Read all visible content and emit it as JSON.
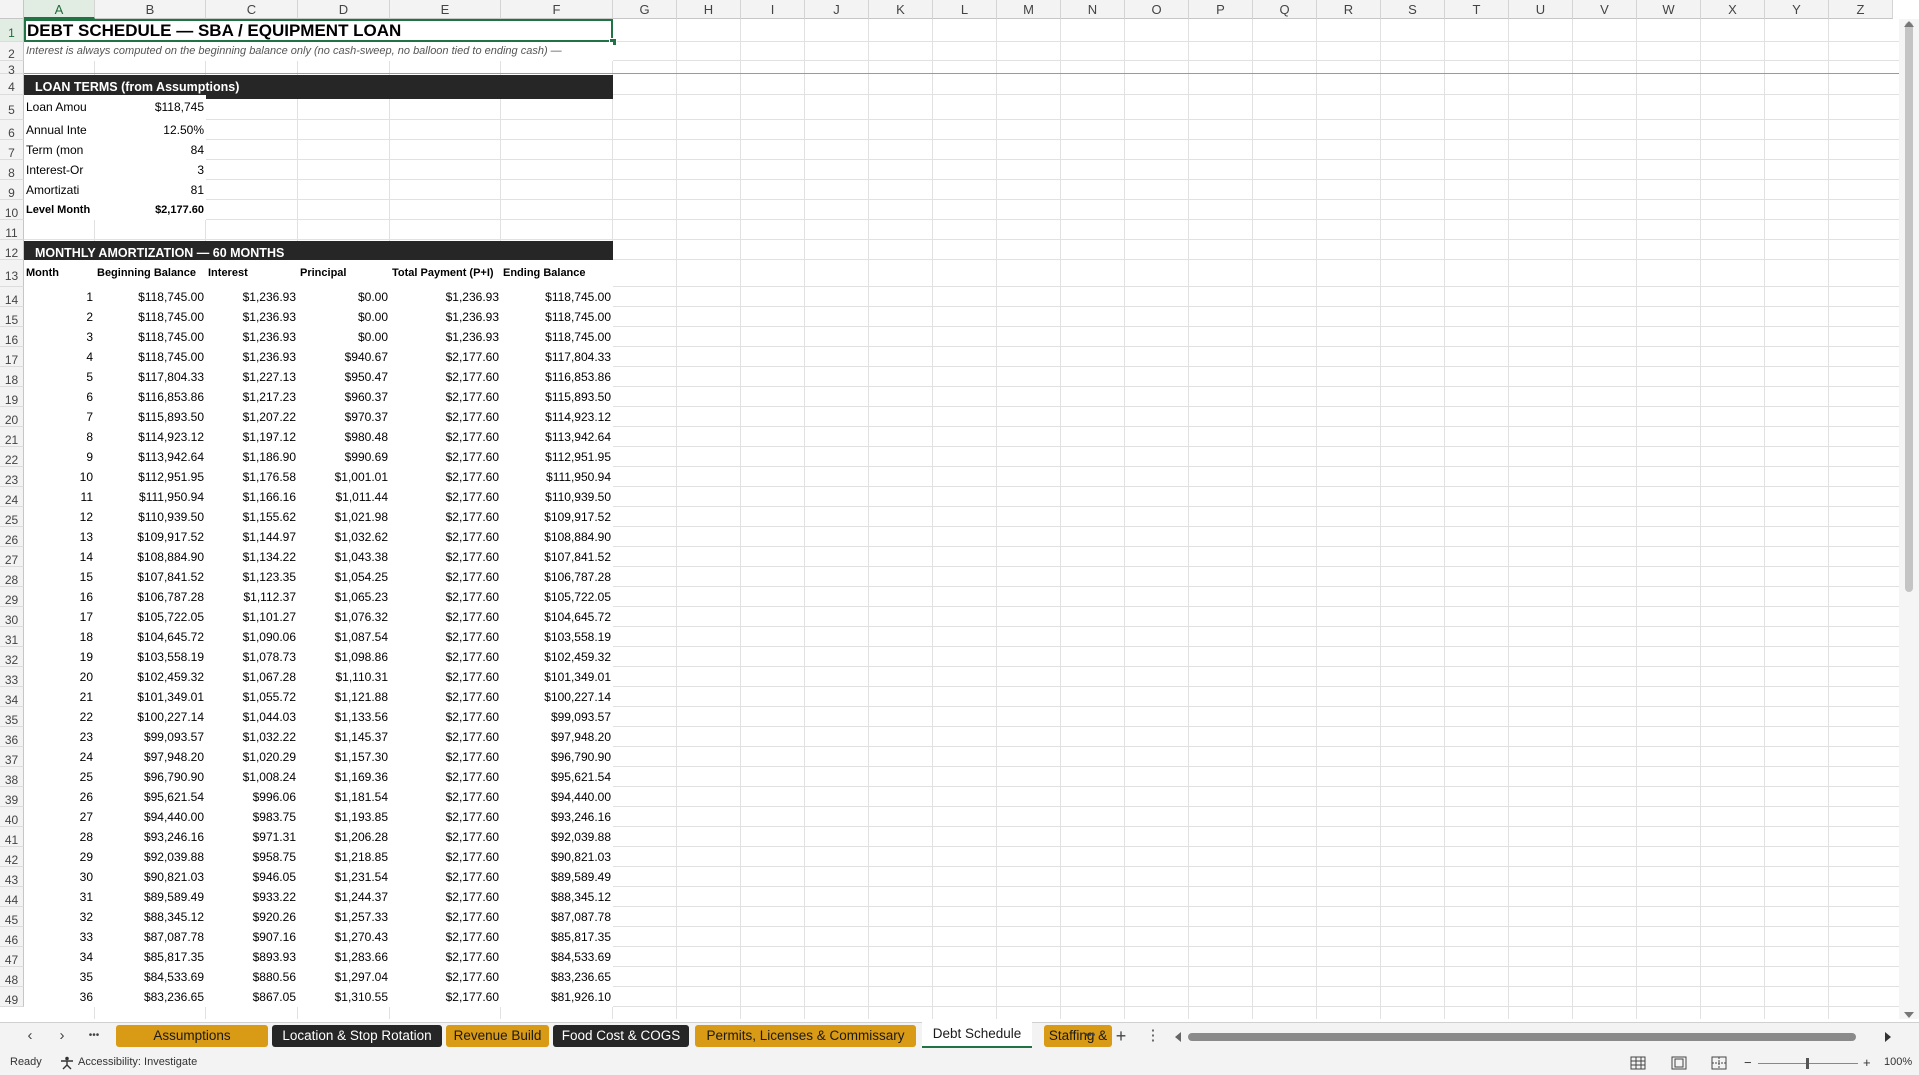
{
  "columns": [
    "A",
    "B",
    "C",
    "D",
    "E",
    "F",
    "G",
    "H",
    "I",
    "J",
    "K",
    "L",
    "M",
    "N",
    "O",
    "P",
    "Q",
    "R",
    "S",
    "T",
    "U",
    "V",
    "W",
    "X",
    "Y",
    "Z"
  ],
  "selected_column": "A",
  "selected_row": "1",
  "sheet": {
    "title": "DEBT SCHEDULE — SBA / EQUIPMENT LOAN",
    "note": "Interest is always computed on the beginning balance only (no cash-sweep, no balloon tied to ending cash) —",
    "loan_terms_header": "LOAN TERMS (from Assumptions)",
    "loan_terms": [
      {
        "label": "Loan Amou",
        "value": "$118,745"
      },
      {
        "label": "Annual Inte",
        "value": "12.50%"
      },
      {
        "label": "Term (mon",
        "value": "84"
      },
      {
        "label": "Interest-Or",
        "value": "3"
      },
      {
        "label": "Amortizati",
        "value": "81"
      },
      {
        "label": "Level Month",
        "value": "$2,177.60"
      }
    ],
    "amort_header": "MONTHLY AMORTIZATION — 60 MONTHS",
    "table_headers": [
      "Month",
      "Beginning Balance",
      "Interest",
      "Principal",
      "Total Payment (P+I)",
      "Ending Balance"
    ],
    "rows": [
      [
        "1",
        "$118,745.00",
        "$1,236.93",
        "$0.00",
        "$1,236.93",
        "$118,745.00"
      ],
      [
        "2",
        "$118,745.00",
        "$1,236.93",
        "$0.00",
        "$1,236.93",
        "$118,745.00"
      ],
      [
        "3",
        "$118,745.00",
        "$1,236.93",
        "$0.00",
        "$1,236.93",
        "$118,745.00"
      ],
      [
        "4",
        "$118,745.00",
        "$1,236.93",
        "$940.67",
        "$2,177.60",
        "$117,804.33"
      ],
      [
        "5",
        "$117,804.33",
        "$1,227.13",
        "$950.47",
        "$2,177.60",
        "$116,853.86"
      ],
      [
        "6",
        "$116,853.86",
        "$1,217.23",
        "$960.37",
        "$2,177.60",
        "$115,893.50"
      ],
      [
        "7",
        "$115,893.50",
        "$1,207.22",
        "$970.37",
        "$2,177.60",
        "$114,923.12"
      ],
      [
        "8",
        "$114,923.12",
        "$1,197.12",
        "$980.48",
        "$2,177.60",
        "$113,942.64"
      ],
      [
        "9",
        "$113,942.64",
        "$1,186.90",
        "$990.69",
        "$2,177.60",
        "$112,951.95"
      ],
      [
        "10",
        "$112,951.95",
        "$1,176.58",
        "$1,001.01",
        "$2,177.60",
        "$111,950.94"
      ],
      [
        "11",
        "$111,950.94",
        "$1,166.16",
        "$1,011.44",
        "$2,177.60",
        "$110,939.50"
      ],
      [
        "12",
        "$110,939.50",
        "$1,155.62",
        "$1,021.98",
        "$2,177.60",
        "$109,917.52"
      ],
      [
        "13",
        "$109,917.52",
        "$1,144.97",
        "$1,032.62",
        "$2,177.60",
        "$108,884.90"
      ],
      [
        "14",
        "$108,884.90",
        "$1,134.22",
        "$1,043.38",
        "$2,177.60",
        "$107,841.52"
      ],
      [
        "15",
        "$107,841.52",
        "$1,123.35",
        "$1,054.25",
        "$2,177.60",
        "$106,787.28"
      ],
      [
        "16",
        "$106,787.28",
        "$1,112.37",
        "$1,065.23",
        "$2,177.60",
        "$105,722.05"
      ],
      [
        "17",
        "$105,722.05",
        "$1,101.27",
        "$1,076.32",
        "$2,177.60",
        "$104,645.72"
      ],
      [
        "18",
        "$104,645.72",
        "$1,090.06",
        "$1,087.54",
        "$2,177.60",
        "$103,558.19"
      ],
      [
        "19",
        "$103,558.19",
        "$1,078.73",
        "$1,098.86",
        "$2,177.60",
        "$102,459.32"
      ],
      [
        "20",
        "$102,459.32",
        "$1,067.28",
        "$1,110.31",
        "$2,177.60",
        "$101,349.01"
      ],
      [
        "21",
        "$101,349.01",
        "$1,055.72",
        "$1,121.88",
        "$2,177.60",
        "$100,227.14"
      ],
      [
        "22",
        "$100,227.14",
        "$1,044.03",
        "$1,133.56",
        "$2,177.60",
        "$99,093.57"
      ],
      [
        "23",
        "$99,093.57",
        "$1,032.22",
        "$1,145.37",
        "$2,177.60",
        "$97,948.20"
      ],
      [
        "24",
        "$97,948.20",
        "$1,020.29",
        "$1,157.30",
        "$2,177.60",
        "$96,790.90"
      ],
      [
        "25",
        "$96,790.90",
        "$1,008.24",
        "$1,169.36",
        "$2,177.60",
        "$95,621.54"
      ],
      [
        "26",
        "$95,621.54",
        "$996.06",
        "$1,181.54",
        "$2,177.60",
        "$94,440.00"
      ],
      [
        "27",
        "$94,440.00",
        "$983.75",
        "$1,193.85",
        "$2,177.60",
        "$93,246.16"
      ],
      [
        "28",
        "$93,246.16",
        "$971.31",
        "$1,206.28",
        "$2,177.60",
        "$92,039.88"
      ],
      [
        "29",
        "$92,039.88",
        "$958.75",
        "$1,218.85",
        "$2,177.60",
        "$90,821.03"
      ],
      [
        "30",
        "$90,821.03",
        "$946.05",
        "$1,231.54",
        "$2,177.60",
        "$89,589.49"
      ],
      [
        "31",
        "$89,589.49",
        "$933.22",
        "$1,244.37",
        "$2,177.60",
        "$88,345.12"
      ],
      [
        "32",
        "$88,345.12",
        "$920.26",
        "$1,257.33",
        "$2,177.60",
        "$87,087.78"
      ],
      [
        "33",
        "$87,087.78",
        "$907.16",
        "$1,270.43",
        "$2,177.60",
        "$85,817.35"
      ],
      [
        "34",
        "$85,817.35",
        "$893.93",
        "$1,283.66",
        "$2,177.60",
        "$84,533.69"
      ],
      [
        "35",
        "$84,533.69",
        "$880.56",
        "$1,297.04",
        "$2,177.60",
        "$83,236.65"
      ],
      [
        "36",
        "$83,236.65",
        "$867.05",
        "$1,310.55",
        "$2,177.60",
        "$81,926.10"
      ]
    ]
  },
  "row_numbers": [
    "1",
    "2",
    "3",
    "4",
    "5",
    "6",
    "7",
    "8",
    "9",
    "10",
    "11",
    "12",
    "13",
    "14",
    "15",
    "16",
    "17",
    "18",
    "19",
    "20",
    "21",
    "22",
    "23",
    "24",
    "25",
    "26",
    "27",
    "28",
    "29",
    "30",
    "31",
    "32",
    "33",
    "34",
    "35",
    "36",
    "37",
    "38",
    "39",
    "40",
    "41",
    "42",
    "43",
    "44",
    "45",
    "46",
    "47",
    "48",
    "49"
  ],
  "tabs": [
    {
      "label": "Assumptions",
      "style": "orange"
    },
    {
      "label": "Location & Stop Rotation",
      "style": "dark"
    },
    {
      "label": "Revenue Build",
      "style": "orange"
    },
    {
      "label": "Food Cost & COGS",
      "style": "dark"
    },
    {
      "label": "Permits, Licenses & Commissary",
      "style": "orange"
    },
    {
      "label": "Debt Schedule",
      "style": "active"
    },
    {
      "label": "Staffing &",
      "style": "orange"
    }
  ],
  "tab_controls": {
    "prev": "‹",
    "next": "›",
    "more_left": "•••",
    "more_right": "•••",
    "add": "+",
    "options": "⋮"
  },
  "status": {
    "ready": "Ready",
    "accessibility": "Accessibility: Investigate",
    "zoom": "100%",
    "zoom_minus": "−",
    "zoom_plus": "+"
  },
  "colors": {
    "accent": "#217346",
    "tab_orange": "#d99a16",
    "tab_dark": "#262626",
    "band": "#262626"
  }
}
